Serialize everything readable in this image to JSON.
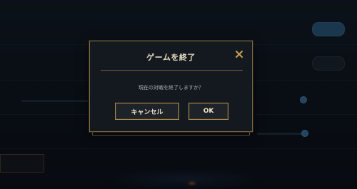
{
  "dialog": {
    "title": "ゲームを終了",
    "message": "現在の対戦を終了しますか？",
    "cancel_label": "キャンセル",
    "ok_label": "OK",
    "close_icon": "close-icon",
    "accent_color": "#c8a050"
  }
}
